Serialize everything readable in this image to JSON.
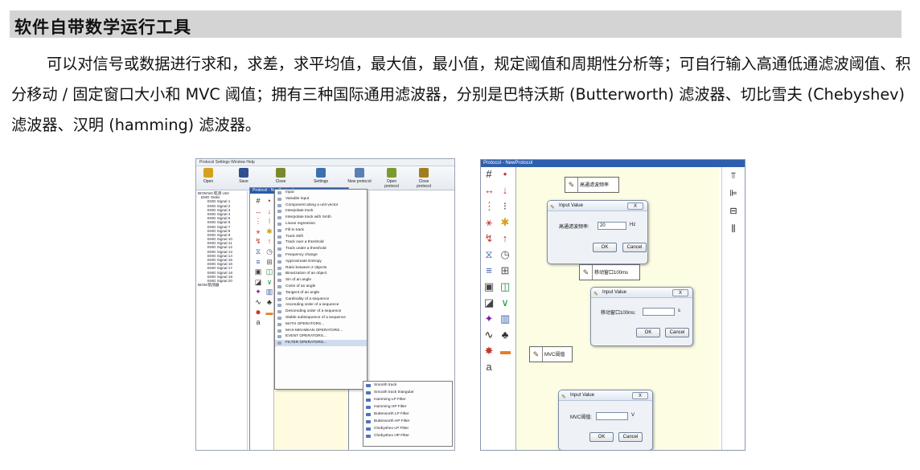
{
  "section": {
    "title": "软件自带数学运行工具"
  },
  "paragraph": "可以对信号或数据进行求和，求差，求平均值，最大值，最小值，规定阈值和周期性分析等；可自行输入高通低通滤波阈值、积分移动 / 固定窗口大小和 MVC 阈值；拥有三种国际通用滤波器，分别是巴特沃斯 (Butterworth) 滤波器、切比雪夫 (Chebyshev) 滤波器、汉明 (hamming) 滤波器。",
  "left_screenshot": {
    "menubar": "Protocol  Settings  Window  Help",
    "toolbar": [
      {
        "label": "Open",
        "color": "#d4a21c"
      },
      {
        "label": "Save",
        "color": "#2f4f8f"
      },
      {
        "label": "Close",
        "color": "#7a8a2a"
      },
      {
        "label": "Settings",
        "color": "#3b6fb0"
      },
      {
        "label": "New protocol",
        "color": "#5a7fb5"
      },
      {
        "label": "Open protocol",
        "color": "#7d9a2c"
      },
      {
        "label": "Close protocol",
        "color": "#a07d1f"
      }
    ],
    "tree": [
      "BIOM'ast 肌测 Unit",
      "EMG Tasks",
      "EMG Signal 1",
      "EMG Signal 2",
      "EMG Signal 3",
      "EMG Signal 4",
      "EMG Signal 5",
      "EMG Signal 6",
      "EMG Signal 7",
      "EMG Signal 8",
      "EMG Signal 9",
      "EMG Signal 10",
      "EMG Signal 11",
      "EMG Signal 12",
      "EMG Signal 13",
      "EMG Signal 14",
      "EMG Signal 15",
      "EMG Signal 16",
      "EMG Signal 17",
      "EMG Signal 18",
      "EMG Signal 19",
      "EMG Signal 20",
      "BIOM'肌测器"
    ],
    "window_title": "Protocol - NewProtocol",
    "context_menu": [
      "Input",
      "Variable Input",
      "Component along a unit vector",
      "Interpolate track",
      "Interpolate track with Smth",
      "Linear regression",
      "Fill in track",
      "Track shift",
      "Track over a threshold",
      "Track under a threshold",
      "Frequency change",
      "Approximate Entropy",
      "Ratio between 2 objects",
      "Binarization of an object",
      "Sin of an angle",
      "Cosin of an angle",
      "Tangent of an angle",
      "Cardinality of a sequence",
      "Ascending order of a sequence",
      "Descending order of a sequence",
      "Stable subsequence of a sequence",
      "MATH OPERATORS...",
      "MAX-MIN-MEAN OPERATORS...",
      "EVENT OPERATORS...",
      "FILTER OPERATORS..."
    ],
    "submenu": [
      "Smooth track",
      "Smooth track triangular",
      "Hamming LP Filter",
      "Hamming HP Filter",
      "Butterworth LP Filter",
      "Butterworth HP Filter",
      "Chebyshev LP Filter",
      "Chebyshev HP Filter"
    ]
  },
  "right_screenshot": {
    "window_title": "Protocol - NewProtocol",
    "blocks": [
      {
        "label": "高通滤波频率"
      },
      {
        "label": "移动窗口100ms"
      },
      {
        "label": "MVC阈值"
      }
    ],
    "dialogs": [
      {
        "title": "Input Value",
        "close": "X",
        "label": "高通滤波频率:",
        "value": "20",
        "unit": "Hz",
        "ok": "OK",
        "cancel": "Cancel"
      },
      {
        "title": "Input Value",
        "close": "X",
        "label": "移动窗口100ms:",
        "value": "",
        "unit": "s",
        "ok": "OK",
        "cancel": "Cancel"
      },
      {
        "title": "Input Value",
        "close": "X",
        "label": "MVC阈值:",
        "value": "",
        "unit": "V",
        "ok": "OK",
        "cancel": "Cancel"
      }
    ]
  },
  "palette_icons": [
    "#",
    "•",
    "↔",
    "↓",
    "⋮",
    "⁝",
    "⚹",
    "✱",
    "↯",
    "↑",
    "⧖",
    "◷",
    "≡",
    "⊞",
    "▣",
    "◫",
    "◪",
    "∨",
    "✦",
    "▥",
    "∿",
    "♣",
    "✸",
    "▬",
    "a"
  ]
}
